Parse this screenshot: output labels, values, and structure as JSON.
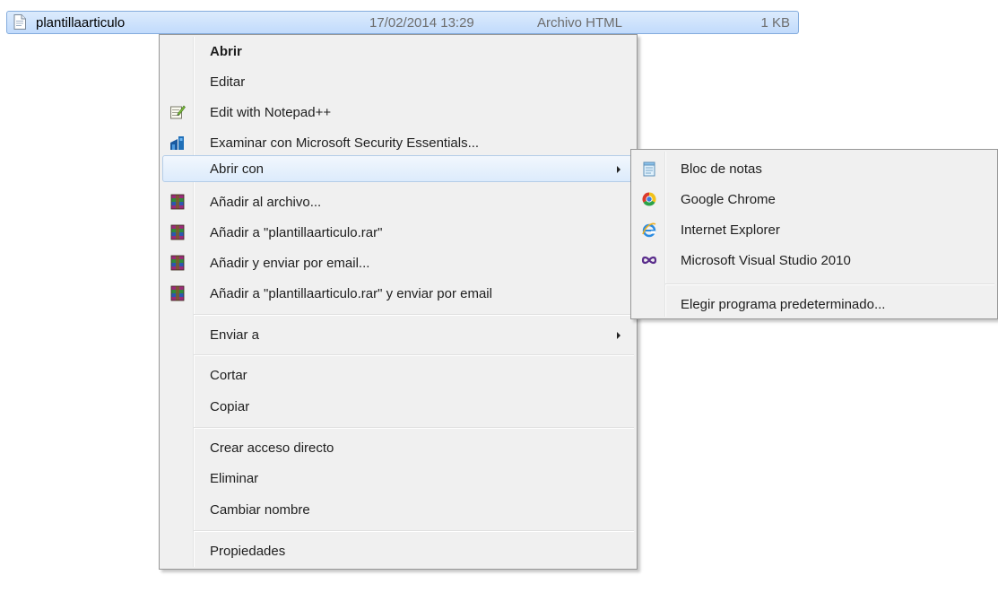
{
  "file_row": {
    "name": "plantillaarticulo",
    "date": "17/02/2014 13:29",
    "type": "Archivo HTML",
    "size": "1 KB",
    "icon": "html-file-icon"
  },
  "context_menu": {
    "items": [
      {
        "label": "Abrir",
        "bold": true
      },
      {
        "label": "Editar"
      },
      {
        "label": "Edit with Notepad++",
        "icon": "notepadpp-icon"
      },
      {
        "label": "Examinar con Microsoft Security Essentials...",
        "icon": "security-essentials-icon"
      },
      {
        "label": "Abrir con",
        "submenu": true,
        "highlighted": true
      },
      {
        "label": "Añadir al archivo...",
        "icon": "winrar-icon"
      },
      {
        "label": "Añadir a \"plantillaarticulo.rar\"",
        "icon": "winrar-icon"
      },
      {
        "label": "Añadir y enviar por email...",
        "icon": "winrar-icon"
      },
      {
        "label": "Añadir a \"plantillaarticulo.rar\" y enviar por email",
        "icon": "winrar-icon"
      },
      {
        "label": "Enviar a",
        "submenu": true
      },
      {
        "label": "Cortar"
      },
      {
        "label": "Copiar"
      },
      {
        "label": "Crear acceso directo"
      },
      {
        "label": "Eliminar"
      },
      {
        "label": "Cambiar nombre"
      },
      {
        "label": "Propiedades"
      }
    ]
  },
  "open_with_submenu": {
    "items": [
      {
        "label": "Bloc de notas",
        "icon": "notepad-icon"
      },
      {
        "label": "Google Chrome",
        "icon": "chrome-icon"
      },
      {
        "label": "Internet Explorer",
        "icon": "internet-explorer-icon"
      },
      {
        "label": "Microsoft Visual Studio 2010",
        "icon": "visual-studio-icon"
      },
      {
        "label": "Elegir programa predeterminado..."
      }
    ]
  },
  "colors": {
    "selection": "#c1dbfc",
    "selection_border": "#84acdd",
    "menu_bg": "#f0f0f0",
    "hover_border": "#b4cde8"
  }
}
